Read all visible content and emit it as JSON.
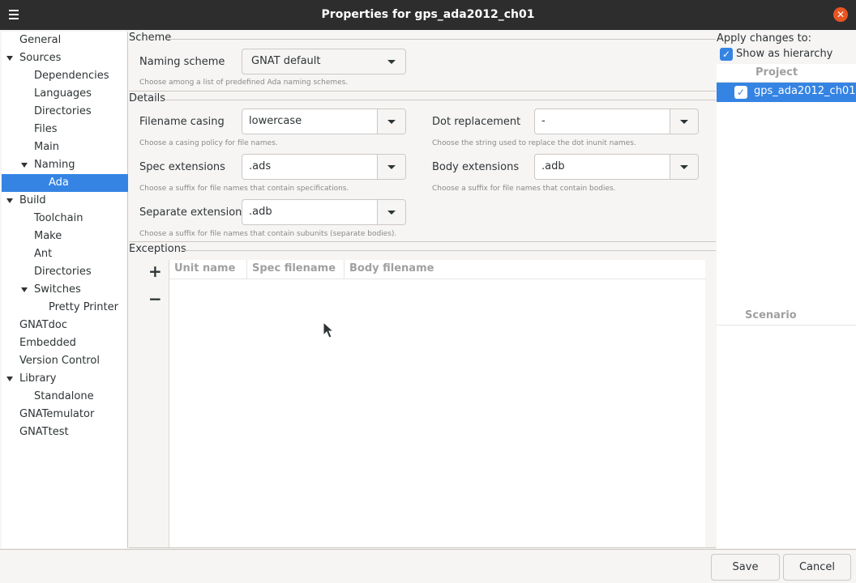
{
  "window": {
    "title": "Properties for gps_ada2012_ch01"
  },
  "sidebar": {
    "items": [
      {
        "label": "General"
      },
      {
        "label": "Sources"
      },
      {
        "label": "Dependencies"
      },
      {
        "label": "Languages"
      },
      {
        "label": "Directories"
      },
      {
        "label": "Files"
      },
      {
        "label": "Main"
      },
      {
        "label": "Naming"
      },
      {
        "label": "Ada"
      },
      {
        "label": "Build"
      },
      {
        "label": "Toolchain"
      },
      {
        "label": "Make"
      },
      {
        "label": "Ant"
      },
      {
        "label": "Directories"
      },
      {
        "label": "Switches"
      },
      {
        "label": "Pretty Printer"
      },
      {
        "label": "GNATdoc"
      },
      {
        "label": "Embedded"
      },
      {
        "label": "Version Control"
      },
      {
        "label": "Library"
      },
      {
        "label": "Standalone"
      },
      {
        "label": "GNATemulator"
      },
      {
        "label": "GNATtest"
      }
    ],
    "selected": "Ada"
  },
  "scheme": {
    "frame_label": "Scheme",
    "naming_label": "Naming scheme",
    "naming_value": "GNAT default",
    "naming_hint": "Choose among a list of predefined Ada naming schemes."
  },
  "details": {
    "frame_label": "Details",
    "filename_casing_label": "Filename casing",
    "filename_casing_value": "lowercase",
    "filename_casing_hint": "Choose a casing policy for file names.",
    "dot_replacement_label": "Dot replacement",
    "dot_replacement_value": "-",
    "dot_replacement_hint": "Choose the string used to replace the dot inunit names.",
    "spec_ext_label": "Spec extensions",
    "spec_ext_value": ".ads",
    "spec_ext_hint": "Choose a suffix for file names that contain specifications.",
    "body_ext_label": "Body extensions",
    "body_ext_value": ".adb",
    "body_ext_hint": "Choose a suffix for file names that contain bodies.",
    "separate_ext_label": "Separate extensions",
    "separate_ext_value": ".adb",
    "separate_ext_hint": "Choose a suffix for file names that contain subunits (separate bodies)."
  },
  "exceptions": {
    "frame_label": "Exceptions",
    "add": "+",
    "remove": "−",
    "columns": [
      "Unit name",
      "Spec filename",
      "Body filename"
    ]
  },
  "apply": {
    "label": "Apply changes to:",
    "show_hierarchy_label": "Show as hierarchy",
    "show_hierarchy_checked": true,
    "project_col": "Project",
    "project_name": "gps_ada2012_ch01",
    "project_checked": true,
    "scenario_col": "Scenario"
  },
  "footer": {
    "save": "Save",
    "cancel": "Cancel"
  },
  "colors": {
    "accent": "#3584e4",
    "titlebar": "#2d2d2d",
    "close": "#e95420"
  }
}
